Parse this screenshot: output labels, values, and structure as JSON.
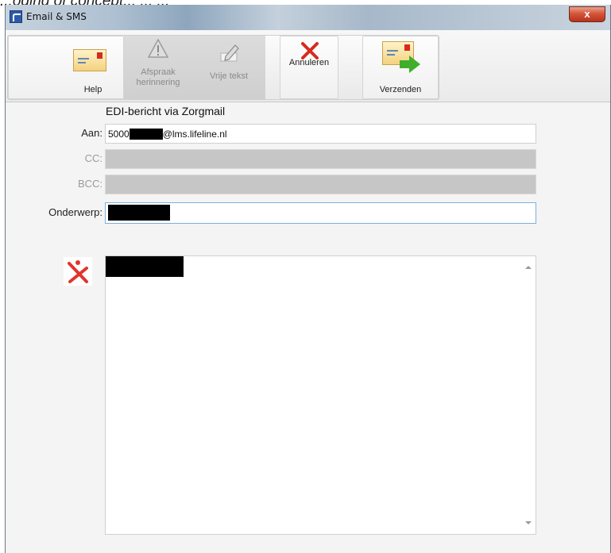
{
  "caption": "...oding of concept... ... ...",
  "window": {
    "title": "Email & SMS",
    "close_glyph": "x"
  },
  "toolbar": {
    "help_label": "Help",
    "appointment_label": "Afspraak herinnering",
    "free_text_label": "Vrije tekst",
    "cancel_label": "Annuleren",
    "send_label": "Verzenden"
  },
  "form": {
    "edi_header": "EDI-bericht via Zorgmail",
    "to_label": "Aan:",
    "to_prefix": "5000",
    "to_suffix": "@lms.lifeline.nl",
    "cc_label": "CC:",
    "bcc_label": "BCC:",
    "subject_label": "Onderwerp:"
  },
  "icons": {
    "help": "mail-icon",
    "appointment": "warning-icon",
    "free_text": "pencil-icon",
    "cancel": "red-x-icon",
    "send": "mail-send-icon",
    "body_logo": "red-x-logo-icon"
  },
  "colors": {
    "accent_red": "#d62b1f",
    "send_green": "#3fae2a",
    "focus_border": "#7eaedb"
  }
}
